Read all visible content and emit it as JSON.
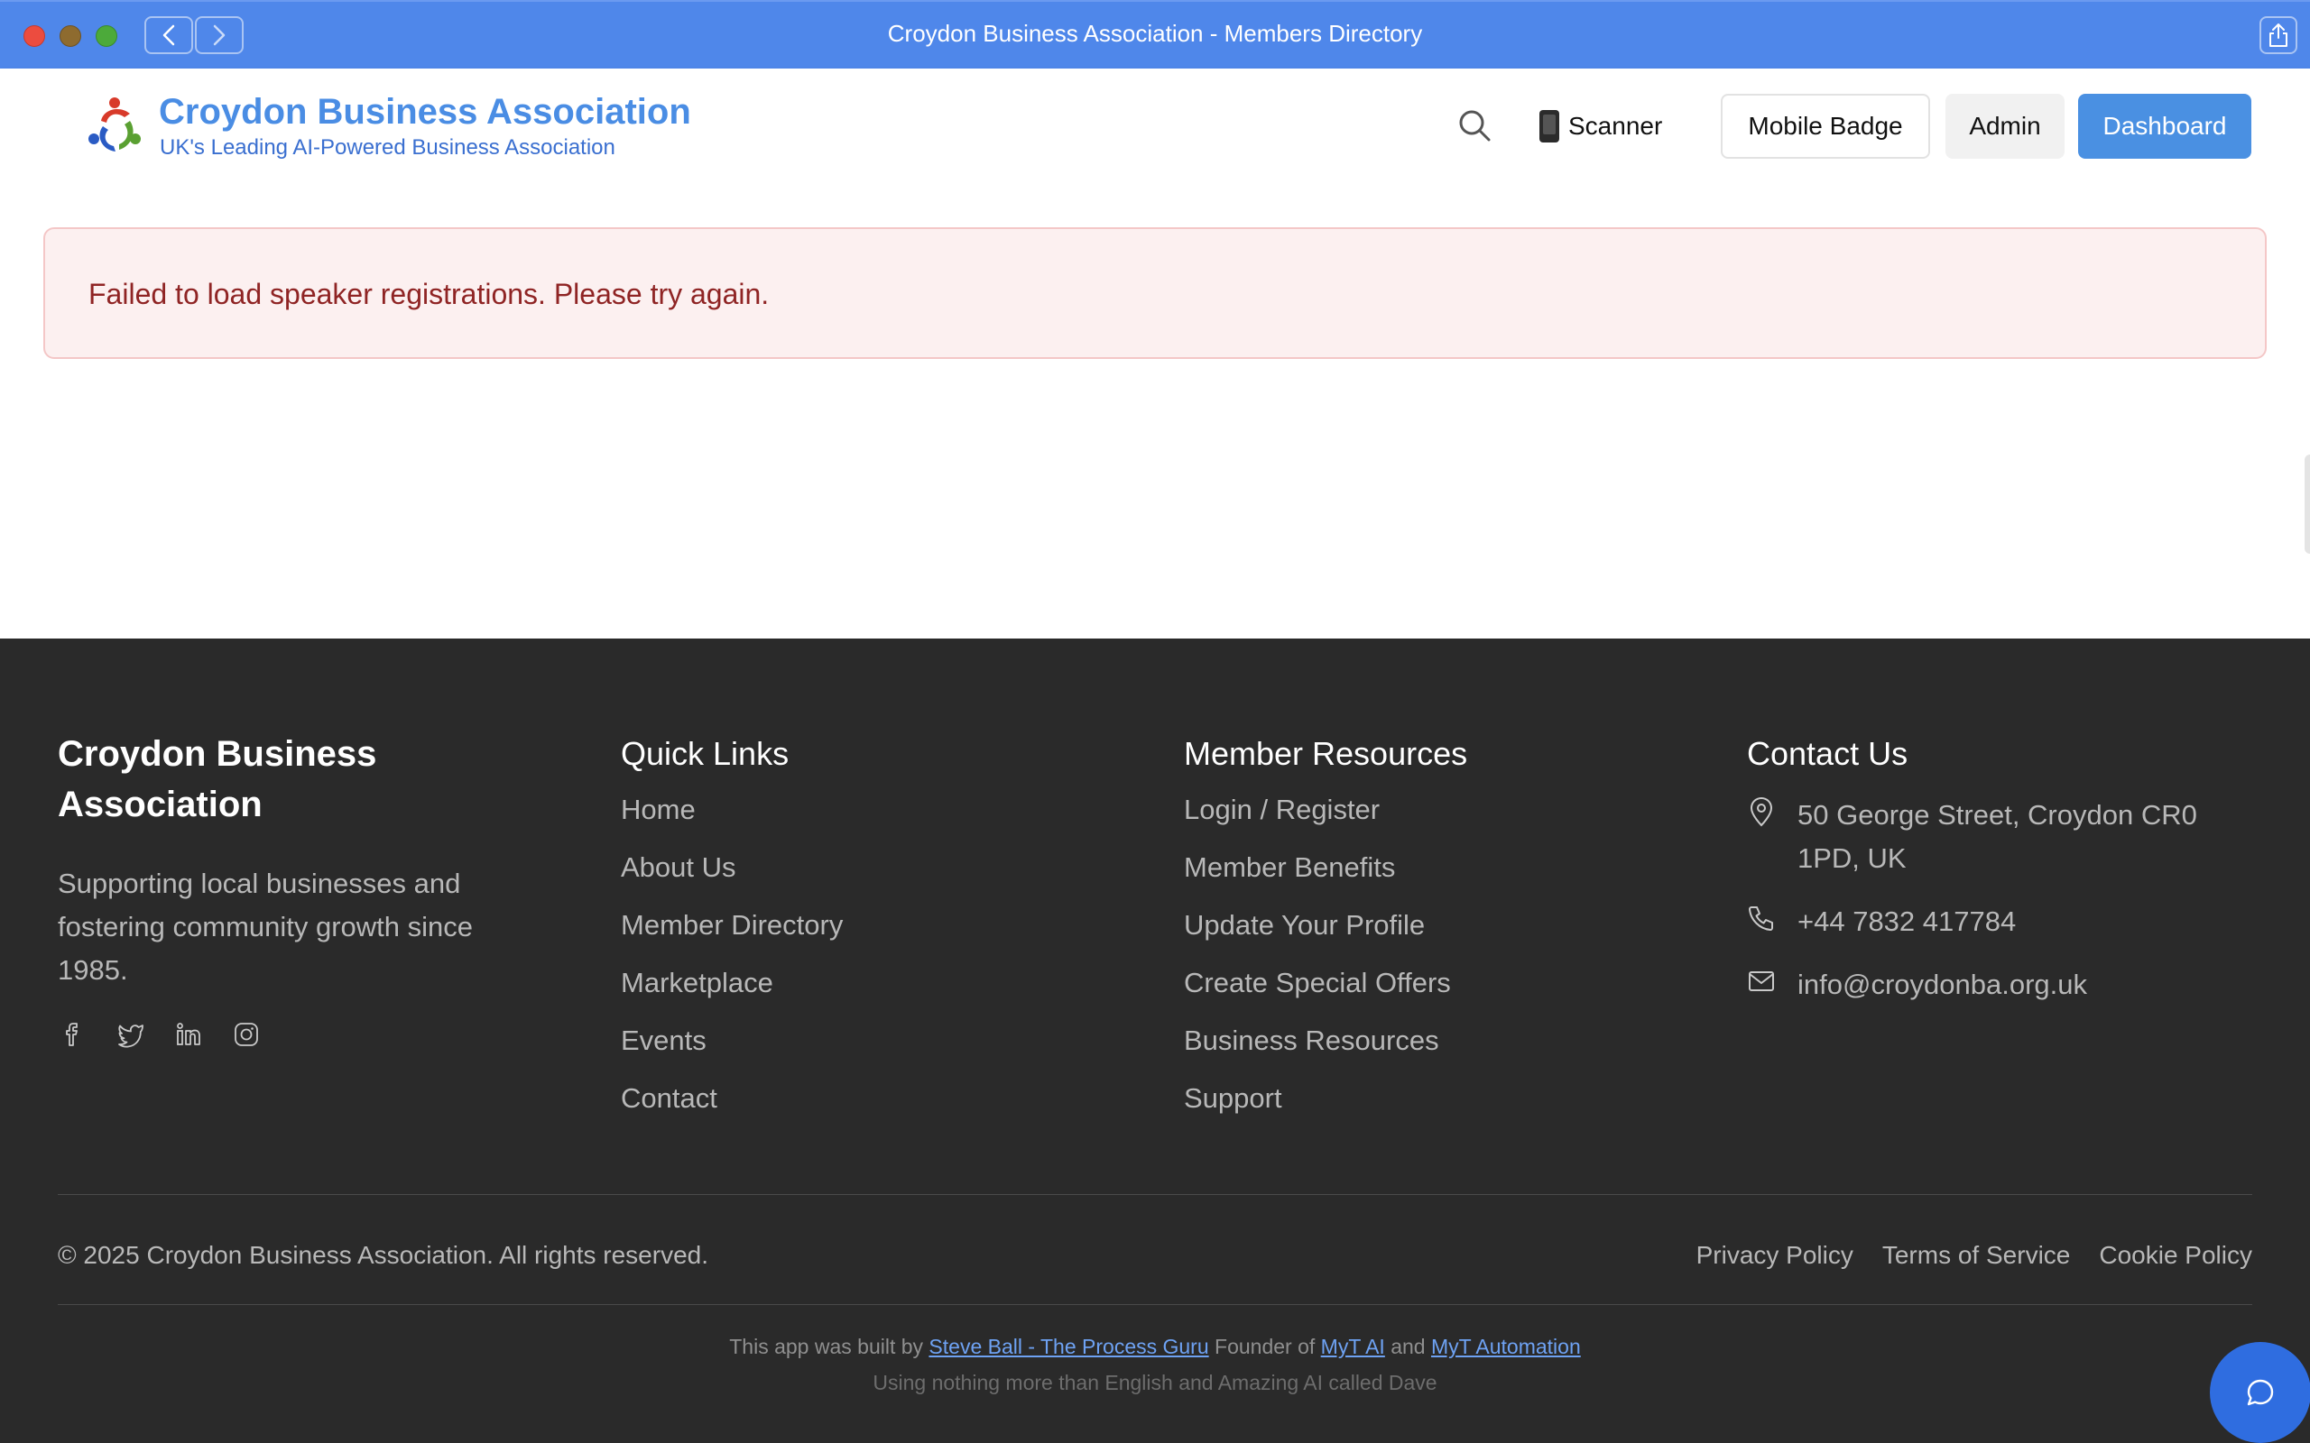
{
  "window": {
    "title": "Croydon Business Association - Members Directory"
  },
  "header": {
    "brand_name": "Croydon Business Association",
    "tagline": "UK's Leading AI-Powered Business Association",
    "scanner_label": "Scanner",
    "mobile_badge_label": "Mobile Badge",
    "admin_label": "Admin",
    "dashboard_label": "Dashboard"
  },
  "main": {
    "error_message": "Failed to load speaker registrations. Please try again."
  },
  "footer": {
    "about": {
      "org_name": "Croydon Business Association",
      "description": "Supporting local businesses and fostering community growth since 1985.",
      "socials": [
        "facebook-icon",
        "twitter-icon",
        "linkedin-icon",
        "instagram-icon"
      ]
    },
    "quick_links": {
      "heading": "Quick Links",
      "items": [
        "Home",
        "About Us",
        "Member Directory",
        "Marketplace",
        "Events",
        "Contact"
      ]
    },
    "member_resources": {
      "heading": "Member Resources",
      "items": [
        "Login / Register",
        "Member Benefits",
        "Update Your Profile",
        "Create Special Offers",
        "Business Resources",
        "Support"
      ]
    },
    "contact": {
      "heading": "Contact Us",
      "address": "50 George Street, Croydon CR0 1PD, UK",
      "phone": "+44 7832 417784",
      "email": "info@croydonba.org.uk"
    },
    "copyright": "© 2025 Croydon Business Association. All rights reserved.",
    "legal": [
      "Privacy Policy",
      "Terms of Service",
      "Cookie Policy"
    ],
    "credit": {
      "prefix": "This app was built by",
      "author": "Steve Ball - The Process Guru",
      "founder_text": "Founder of",
      "company1": "MyT AI",
      "and_text": "and",
      "company2": "MyT Automation",
      "tagline": "Using nothing more than English and Amazing AI called Dave"
    }
  },
  "colors": {
    "titlebar": "#4f87ea",
    "brand": "#4a8de4",
    "primary_button": "#4a90e2",
    "error_text": "#8f2424",
    "error_bg": "#fcf0f0",
    "footer_bg": "#2a2a2a",
    "chat_button": "#2f6de0"
  }
}
